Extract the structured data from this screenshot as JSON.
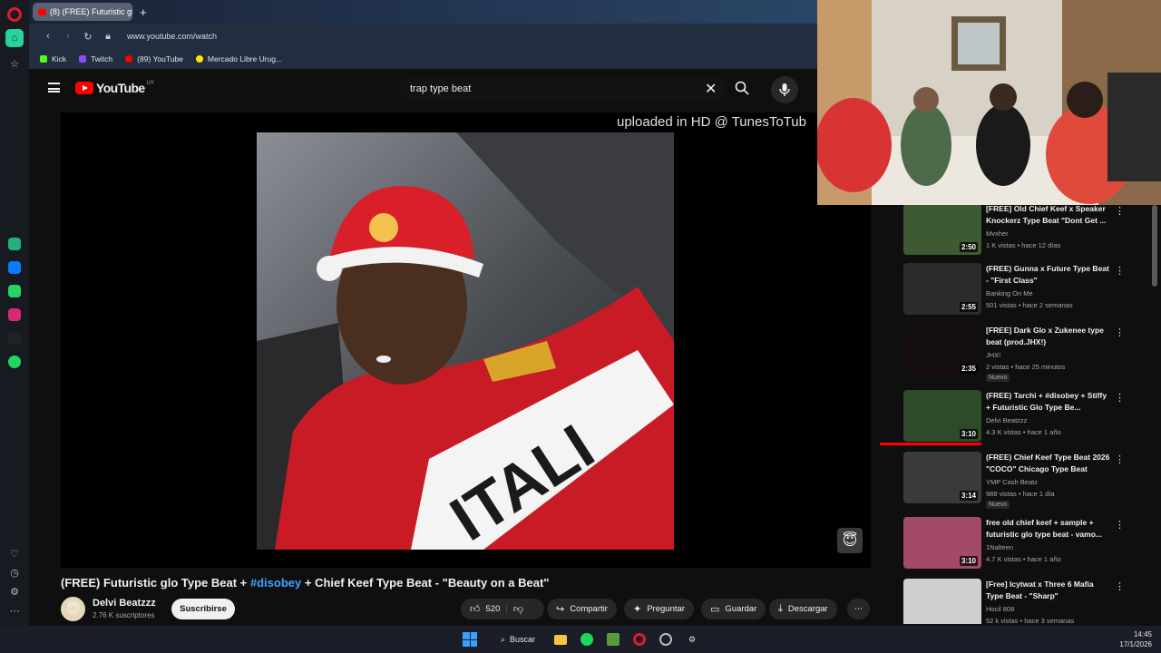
{
  "browser": {
    "tab_title": "(8) (FREE) Futuristic gl",
    "url": "www.youtube.com/watch",
    "bookmarks": [
      {
        "label": "Kick",
        "color": "#53fc18"
      },
      {
        "label": "Twitch",
        "color": "#9146ff"
      },
      {
        "label": "(89) YouTube",
        "color": "#ff0000"
      },
      {
        "label": "Mercado Libre Urug...",
        "color": "#ffe600"
      }
    ]
  },
  "youtube": {
    "logo_text": "YouTube",
    "region": "UY",
    "search_value": "trap type beat"
  },
  "player": {
    "watermark": "uploaded in HD @ TunesToTub",
    "jersey_text": "ITALI"
  },
  "video": {
    "title_part1": "(FREE) Futuristic glo Type Beat + ",
    "hashtag": "#disobey",
    "title_part2": " + Chief Keef Type Beat - \"Beauty on a Beat\"",
    "channel": "Delvi Beatzzz",
    "subscribers": "2.76 K suscriptores",
    "subscribe_label": "Suscribirse",
    "likes": "520",
    "share_label": "Compartir",
    "ask_label": "Preguntar",
    "save_label": "Guardar",
    "download_label": "Descargar"
  },
  "recommendations": [
    {
      "title": "[FREE] Old Chief Keef x Speaker Knockerz Type Beat \"Dont Get ...",
      "channel": "Mvxher",
      "meta": "1 K vistas • hace 12 días",
      "duration": "2:50",
      "badge": "",
      "thumb_color": "#4a7a3a"
    },
    {
      "title": "(FREE) Gunna x Future Type Beat - \"First Class\"",
      "channel": "Banking On Me",
      "meta": "501 vistas • hace 2 semanas",
      "duration": "2:55",
      "badge": "",
      "thumb_color": "#2b2b2b"
    },
    {
      "title": "[FREE] Dark Glo x Zukenee type beat (prod.JHX!)",
      "channel": "JHX!",
      "meta": "2 vistas • hace 25 minutos",
      "duration": "2:35",
      "badge": "Nuevo",
      "thumb_color": "#140d0d"
    },
    {
      "title": "(FREE) Tarchi + #disobey + Stiffy + Futuristic Glo Type Be...",
      "channel": "Delvi Beatzzz",
      "meta": "4.3 K vistas • hace 1 año",
      "duration": "3:10",
      "badge": "",
      "thumb_color": "#2f4a2a"
    },
    {
      "title": "(FREE) Chief Keef Type Beat 2026 \"COCO\" Chicago Type Beat",
      "channel": "YMP Cash Beatz",
      "meta": "988 vistas • hace 1 día",
      "duration": "3:14",
      "badge": "Nuevo",
      "thumb_color": "#3a3a3a"
    },
    {
      "title": "free old chief keef + sample + futuristic glo type beat - vamo...",
      "channel": "1Nalteen",
      "meta": "4.7 K vistas • hace 1 año",
      "duration": "3:10",
      "badge": "",
      "thumb_color": "#a34a6a"
    },
    {
      "title": "[Free] Icytwat x Three 6 Mafia Type Beat - \"Sharp\"",
      "channel": "Hocil 808",
      "meta": "52 k vistas • hace 3 semanas",
      "duration": "",
      "badge": "",
      "thumb_color": "#cfcfcf"
    }
  ],
  "taskbar": {
    "search_label": "Buscar",
    "time": "14:45",
    "date": "17/1/2026"
  }
}
